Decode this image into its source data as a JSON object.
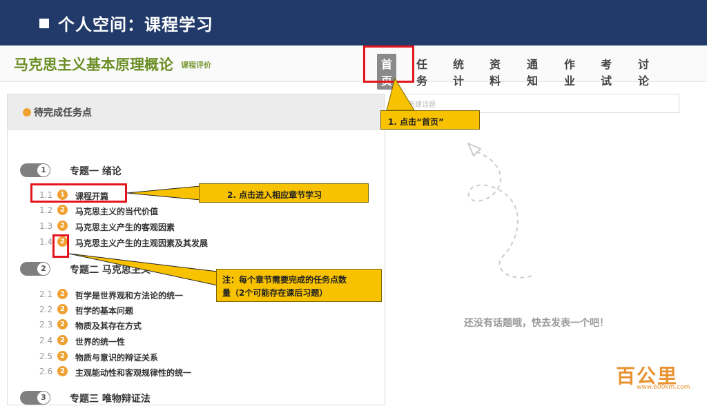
{
  "slide": {
    "title": "个人空间：课程学习"
  },
  "course": {
    "name": "马克思主义基本原理概论",
    "eval_link": "课程评价"
  },
  "nav": [
    "首页",
    "任务",
    "统计",
    "资料",
    "通知",
    "作业",
    "考试",
    "讨论"
  ],
  "panel": {
    "title": "待完成任务点"
  },
  "topics": [
    {
      "num": "1",
      "title": "专题一 绪论"
    },
    {
      "num": "2",
      "title": "专题二 马克思主义"
    },
    {
      "num": "3",
      "title": "专题三 唯物辩证法"
    }
  ],
  "sections": [
    {
      "no": "1.1",
      "count": "1",
      "name": "课程开篇"
    },
    {
      "no": "1.2",
      "count": "2",
      "name": "马克思主义的当代价值"
    },
    {
      "no": "1.3",
      "count": "2",
      "name": "马克思主义产生的客观因素"
    },
    {
      "no": "1.4",
      "count": "2",
      "name": "马克思主义产生的主观因素及其发展"
    },
    {
      "no": "2.1",
      "count": "2",
      "name": "哲学是世界观和方法论的统一"
    },
    {
      "no": "2.2",
      "count": "2",
      "name": "哲学的基本问题"
    },
    {
      "no": "2.3",
      "count": "2",
      "name": "物质及其存在方式"
    },
    {
      "no": "2.4",
      "count": "2",
      "name": "世界的统一性"
    },
    {
      "no": "2.5",
      "count": "2",
      "name": "物质与意识的辩证关系"
    },
    {
      "no": "2.6",
      "count": "2",
      "name": "主观能动性和客观规律性的统一"
    }
  ],
  "discussion": {
    "placeholder": "新建话题",
    "empty": "还没有话题哦，快去发表一个吧！"
  },
  "callouts": {
    "c1": "1. 点击“首页”",
    "c2": "2. 点击进入相应章节学习",
    "c3_line1": "注：每个章节需要完成的任务点数",
    "c3_line2": "量（2个可能存在课后习题）"
  },
  "logo": {
    "text": "百公里",
    "url": "www.600km.com"
  },
  "colors": {
    "header_bg": "#213a6a",
    "accent_orange": "#f0a030",
    "highlight_red": "#e3141b",
    "callout_yellow": "#f8c200"
  }
}
